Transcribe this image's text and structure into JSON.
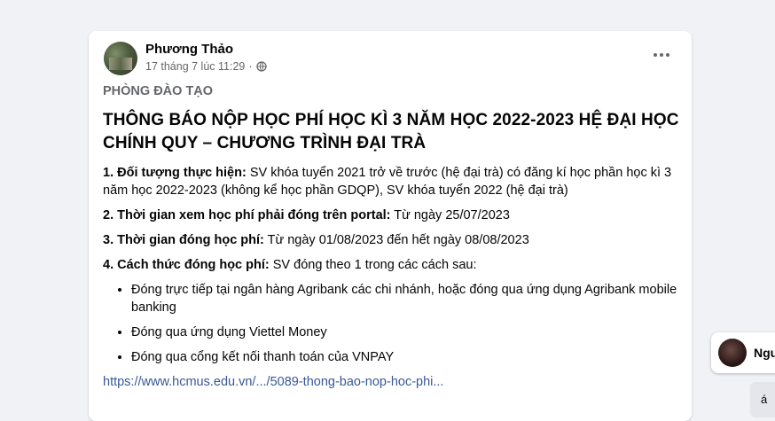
{
  "post": {
    "author": "Phương Thảo",
    "timestamp": "17 tháng 7 lúc 11:29",
    "separator": "·",
    "privacy_icon": "globe-icon",
    "more_icon": "more-options-icon",
    "department": "PHÒNG ĐÀO TẠO",
    "headline": "THÔNG BÁO NỘP HỌC PHÍ HỌC KÌ 3 NĂM HỌC 2022-2023 HỆ ĐẠI HỌC CHÍNH QUY – CHƯƠNG TRÌNH ĐẠI TRÀ",
    "items": [
      {
        "label": "1. Đối tượng thực hiện:",
        "text": " SV khóa tuyển 2021 trở về trước (hệ đại trà) có đăng kí học phần học kì 3 năm học 2022-2023 (không kể học phần GDQP), SV khóa tuyển 2022 (hệ đại trà)"
      },
      {
        "label": "2. Thời gian xem học phí phải đóng trên portal:",
        "text": " Từ ngày 25/07/2023"
      },
      {
        "label": "3. Thời gian đóng học phí:",
        "text": " Từ ngày 01/08/2023 đến hết ngày 08/08/2023"
      },
      {
        "label": "4. Cách thức đóng học phí:",
        "text": " SV đóng theo 1 trong các cách sau:"
      }
    ],
    "methods": [
      "Đóng trực tiếp tại ngân hàng Agribank các chi nhánh, hoặc đóng qua ứng dụng Agribank mobile banking",
      "Đóng qua ứng dụng Viettel Money",
      "Đóng qua cổng kết nối thanh toán của VNPAY"
    ],
    "link": "https://www.hcmus.edu.vn/.../5089-thong-bao-nop-hoc-phi..."
  },
  "chat": {
    "name_partial": "Ngu",
    "bubble_text": "á"
  }
}
